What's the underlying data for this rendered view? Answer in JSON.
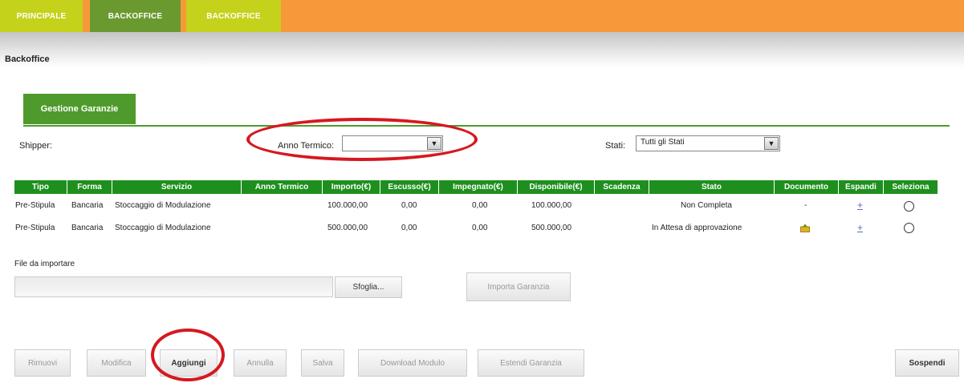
{
  "tabs": [
    "PRINCIPALE",
    "BACKOFFICE",
    "BACKOFFICE"
  ],
  "breadcrumb": "Backoffice",
  "section_tab": "Gestione Garanzie",
  "filters": {
    "shipper_label": "Shipper:",
    "anno_label": "Anno Termico:",
    "anno_value": "",
    "stati_label": "Stati:",
    "stati_value": "Tutti gli Stati"
  },
  "table": {
    "headers": [
      "Tipo",
      "Forma",
      "Servizio",
      "Anno Termico",
      "Importo(€)",
      "Escusso(€)",
      "Impegnato(€)",
      "Disponibile(€)",
      "Scadenza",
      "Stato",
      "Documento",
      "Espandi",
      "Seleziona"
    ],
    "rows": [
      {
        "tipo": "Pre-Stipula",
        "forma": "Bancaria",
        "servizio": "Stoccaggio di Modulazione",
        "anno": "",
        "importo": "100.000,00",
        "escusso": "0,00",
        "impegnato": "0,00",
        "disponibile": "100.000,00",
        "scadenza": "",
        "stato": "Non Completa",
        "documento": "-",
        "espandi": "+"
      },
      {
        "tipo": "Pre-Stipula",
        "forma": "Bancaria",
        "servizio": "Stoccaggio di Modulazione",
        "anno": "",
        "importo": "500.000,00",
        "escusso": "0,00",
        "impegnato": "0,00",
        "disponibile": "500.000,00",
        "scadenza": "",
        "stato": "In Attesa di approvazione",
        "documento": "document-icon",
        "espandi": "+"
      }
    ]
  },
  "import": {
    "file_label": "File da importare",
    "file_value": "",
    "browse_label": "Sfoglia...",
    "import_label": "Importa Garanzia"
  },
  "actions": {
    "rimuovi": "Rimuovi",
    "modifica": "Modifica",
    "aggiungi": "Aggiungi",
    "annulla": "Annulla",
    "salva": "Salva",
    "download": "Download Modulo",
    "estendi": "Estendi Garanzia",
    "sospendi": "Sospendi"
  },
  "colors": {
    "orange": "#f7993a",
    "lime": "#c5d21c",
    "green": "#4f9a2c",
    "table_header": "#1e8f1e",
    "highlight_ring": "#d61820"
  }
}
